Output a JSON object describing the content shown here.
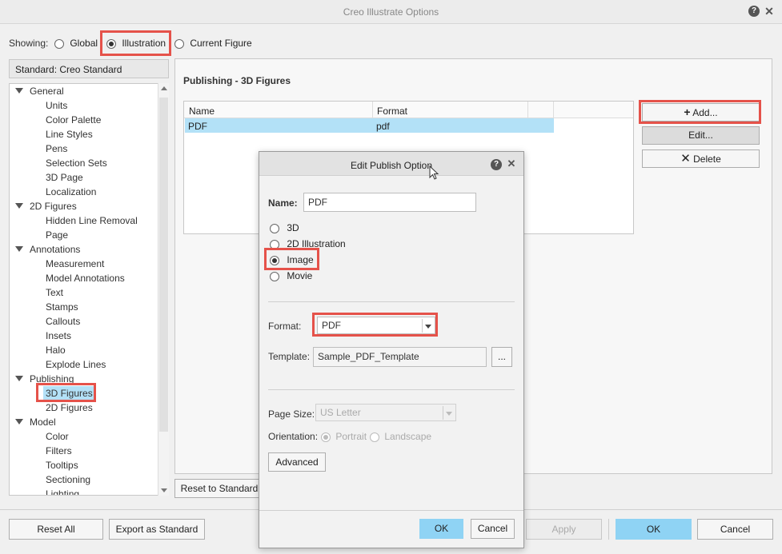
{
  "window": {
    "title": "Creo Illustrate Options"
  },
  "showing": {
    "label": "Showing:",
    "options": [
      "Global",
      "Illustration",
      "Current Figure"
    ],
    "selected": "Illustration"
  },
  "standard_label": "Standard: Creo Standard",
  "tree": {
    "general": {
      "label": "General",
      "children": [
        "Units",
        "Color Palette",
        "Line Styles",
        "Pens",
        "Selection Sets",
        "3D Page",
        "Localization"
      ]
    },
    "figures2d": {
      "label": "2D Figures",
      "children": [
        "Hidden Line Removal",
        "Page"
      ]
    },
    "annotations": {
      "label": "Annotations",
      "children": [
        "Measurement",
        "Model Annotations",
        "Text",
        "Stamps",
        "Callouts",
        "Insets",
        "Halo",
        "Explode Lines"
      ]
    },
    "publishing": {
      "label": "Publishing",
      "children": [
        "3D Figures",
        "2D Figures"
      ]
    },
    "model": {
      "label": "Model",
      "children": [
        "Color",
        "Filters",
        "Tooltips",
        "Sectioning",
        "Lighting"
      ]
    }
  },
  "panel": {
    "title": "Publishing - 3D Figures",
    "columns": [
      "Name",
      "Format"
    ],
    "rows": [
      {
        "name": "PDF",
        "format": "pdf"
      }
    ],
    "add_label": "Add...",
    "edit_label": "Edit...",
    "delete_label": "Delete",
    "reset_label": "Reset to Standard"
  },
  "dialog": {
    "title": "Edit Publish Option",
    "name_label": "Name:",
    "name_value": "PDF",
    "types": [
      "3D",
      "2D Illustration",
      "Image",
      "Movie"
    ],
    "selected_type": "Image",
    "format_label": "Format:",
    "format_value": "PDF",
    "template_label": "Template:",
    "template_value": "Sample_PDF_Template",
    "browse_label": "...",
    "page_size_label": "Page Size:",
    "page_size_value": "US Letter",
    "orientation_label": "Orientation:",
    "orientation_options": [
      "Portrait",
      "Landscape"
    ],
    "orientation_selected": "Portrait",
    "advanced_label": "Advanced",
    "ok_label": "OK",
    "cancel_label": "Cancel"
  },
  "footer": {
    "reset_all": "Reset All",
    "export_standard": "Export as Standard",
    "apply": "Apply",
    "ok": "OK",
    "cancel": "Cancel"
  },
  "colors": {
    "highlight": "#e5524a",
    "selection": "#b3e1f7",
    "primary_button": "#8fd3f4"
  }
}
